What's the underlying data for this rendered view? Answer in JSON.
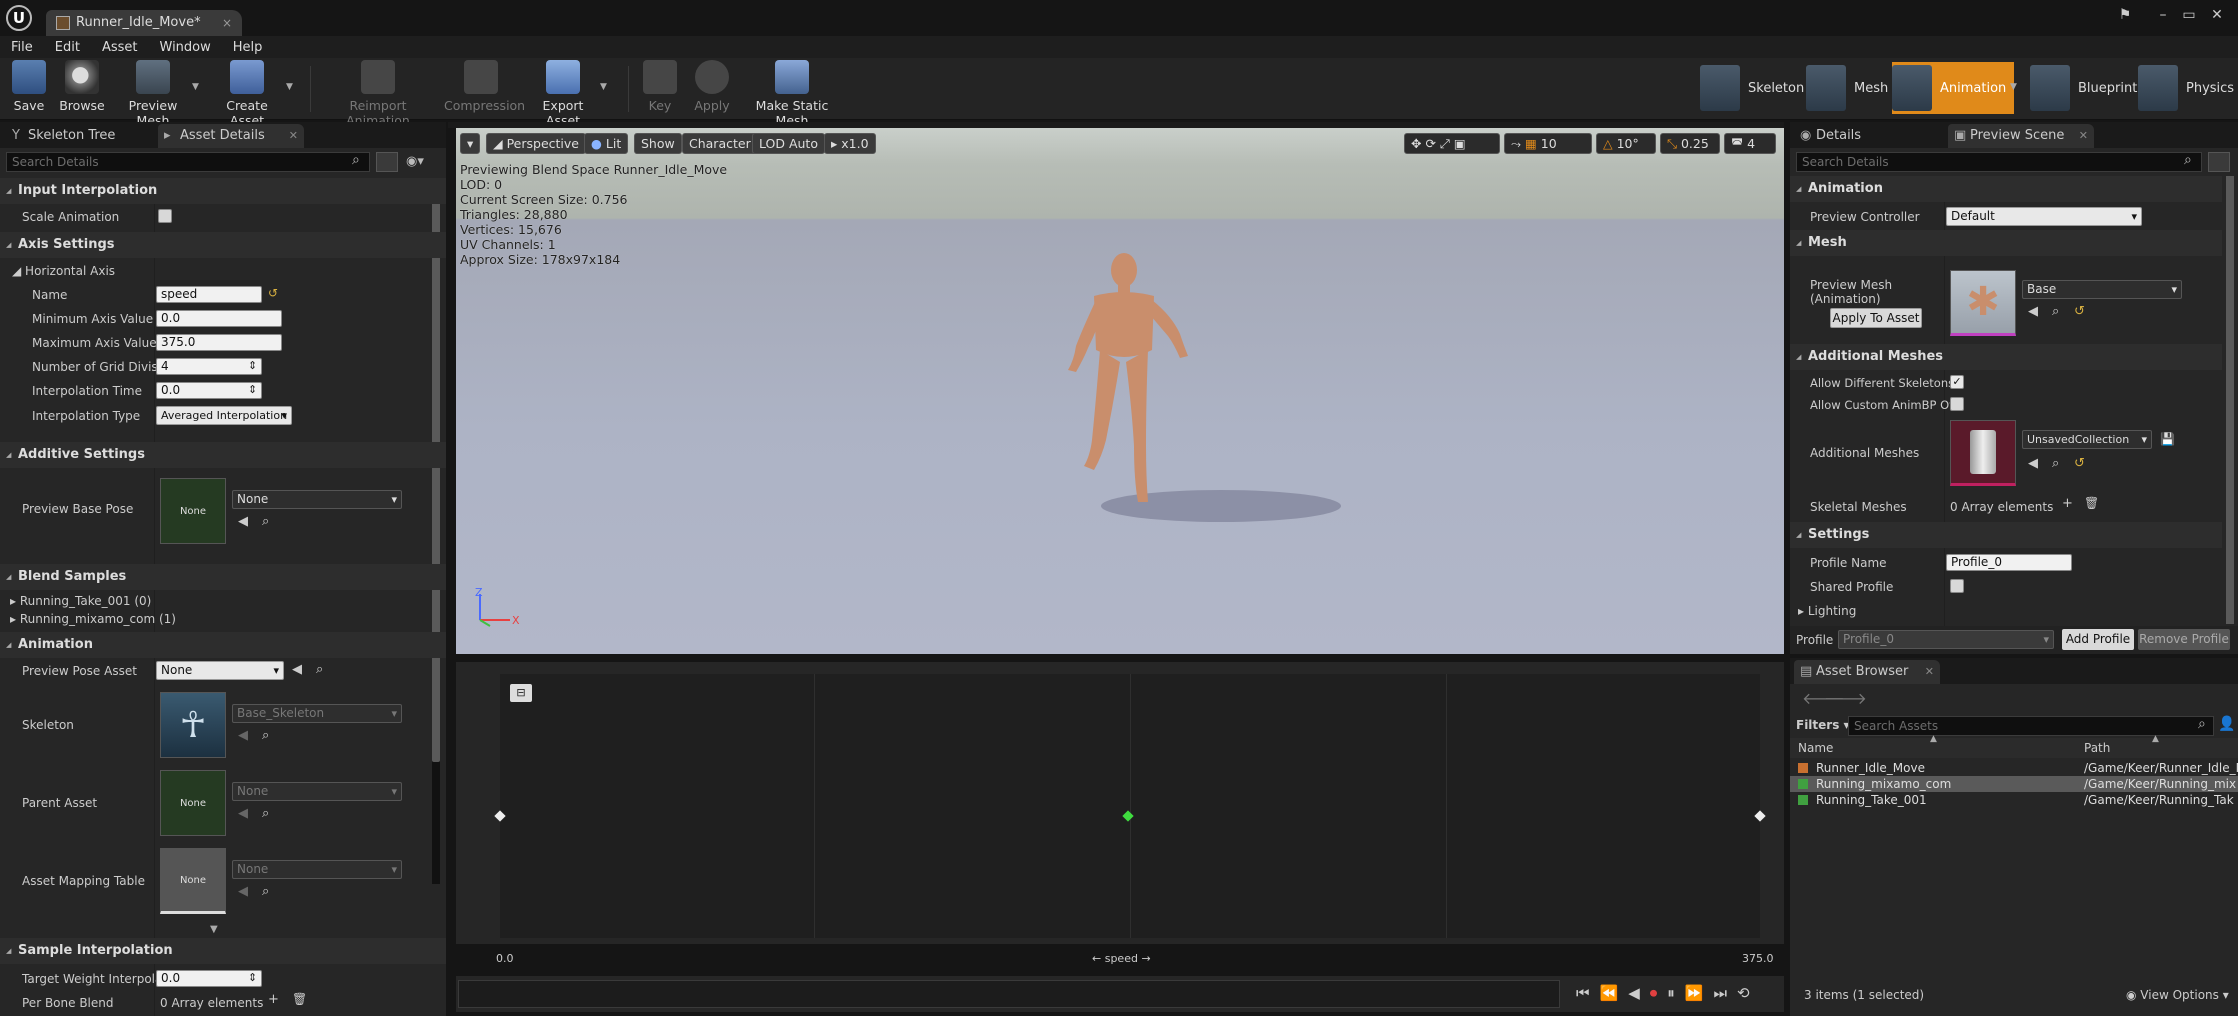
{
  "title_bar": {
    "tab_title": "Runner_Idle_Move*",
    "close_glyph": "×",
    "logo_glyph": "U"
  },
  "menu": [
    "File",
    "Edit",
    "Asset",
    "Window",
    "Help"
  ],
  "toolbar": {
    "save": "Save",
    "browse": "Browse",
    "preview_mesh": "Preview Mesh",
    "create_asset": "Create Asset",
    "reimport": "Reimport Animation",
    "compression": "Compression",
    "export_asset": "Export Asset",
    "key": "Key",
    "apply": "Apply",
    "make_static_mesh": "Make Static Mesh"
  },
  "modes": {
    "skeleton": "Skeleton",
    "mesh": "Mesh",
    "animation": "Animation",
    "blueprint": "Blueprint",
    "physics": "Physics"
  },
  "left_panel": {
    "tabs": {
      "skeleton_tree": "Skeleton Tree",
      "asset_details": "Asset Details"
    },
    "search_placeholder": "Search Details",
    "input_interpolation": {
      "header": "Input Interpolation",
      "scale_animation": "Scale Animation"
    },
    "axis_settings": {
      "header": "Axis Settings",
      "horizontal_axis": "Horizontal Axis",
      "name_label": "Name",
      "name_value": "speed",
      "min_label": "Minimum Axis Value",
      "min_value": "0.0",
      "max_label": "Maximum Axis Value",
      "max_value": "375.0",
      "grid_label": "Number of Grid Division",
      "grid_value": "4",
      "interp_time_label": "Interpolation Time",
      "interp_time_value": "0.0",
      "interp_type_label": "Interpolation Type",
      "interp_type_value": "Averaged Interpolation"
    },
    "additive": {
      "header": "Additive Settings",
      "preview_base_pose": "Preview Base Pose",
      "thumb_text": "None",
      "value": "None"
    },
    "blend_samples": {
      "header": "Blend Samples",
      "items": [
        "Running_Take_001 (0)",
        "Running_mixamo_com (1)"
      ]
    },
    "animation": {
      "header": "Animation",
      "preview_pose_label": "Preview Pose Asset",
      "preview_pose_value": "None",
      "skeleton_label": "Skeleton",
      "skeleton_value": "Base_Skeleton",
      "parent_label": "Parent Asset",
      "parent_value": "None",
      "parent_thumb": "None",
      "mapping_label": "Asset Mapping Table",
      "mapping_value": "None",
      "mapping_thumb": "None"
    },
    "sample_interp": {
      "header": "Sample Interpolation",
      "target_label": "Target Weight Interpolatio",
      "target_value": "0.0",
      "per_bone_label": "Per Bone Blend",
      "per_bone_value": "0 Array elements"
    }
  },
  "viewport": {
    "buttons": {
      "perspective": "Perspective",
      "lit": "Lit",
      "show": "Show",
      "character": "Character",
      "lod": "LOD Auto",
      "speed": "x1.0"
    },
    "right_values": {
      "grid": "10",
      "angle": "10°",
      "scale": "0.25",
      "cam": "4"
    },
    "stats": [
      "Previewing Blend Space Runner_Idle_Move",
      "LOD: 0",
      "Current Screen Size: 0.756",
      "Triangles: 28,880",
      "Vertices: 15,676",
      "UV Channels: 1",
      "Approx Size: 178x97x184"
    ],
    "axis_labels": {
      "x": "X",
      "z": "Z"
    }
  },
  "blend_space": {
    "x_min": "0.0",
    "x_max": "375.0",
    "axis_name": "speed",
    "left_arrow": "←",
    "right_arrow": "→"
  },
  "right_panel": {
    "tabs": {
      "details": "Details",
      "preview_scene": "Preview Scene Sett"
    },
    "search_placeholder": "Search Details",
    "animation": {
      "header": "Animation",
      "preview_controller_label": "Preview Controller",
      "preview_controller_value": "Default"
    },
    "mesh": {
      "header": "Mesh",
      "preview_mesh_label": "Preview Mesh (Animation)",
      "preview_mesh_value": "Base",
      "apply_button": "Apply To Asset"
    },
    "additional": {
      "header": "Additional Meshes",
      "allow_diff": "Allow Different Skeletons",
      "allow_custom": "Allow Custom AnimBP Ov",
      "additional_label": "Additional Meshes",
      "additional_value": "UnsavedCollection",
      "skeletal_label": "Skeletal Meshes",
      "skeletal_value": "0 Array elements"
    },
    "settings": {
      "header": "Settings",
      "profile_name_label": "Profile Name",
      "profile_name_value": "Profile_0",
      "shared_label": "Shared Profile",
      "lighting": "Lighting"
    },
    "profile_bar": {
      "label": "Profile",
      "value": "Profile_0",
      "add": "Add Profile",
      "remove": "Remove Profile"
    }
  },
  "asset_browser": {
    "tab": "Asset Browser",
    "filters": "Filters",
    "search_placeholder": "Search Assets",
    "col_name": "Name",
    "col_path": "Path",
    "rows": [
      {
        "name": "Runner_Idle_Move",
        "path": "/Game/Keer/Runner_Idle_M"
      },
      {
        "name": "Running_mixamo_com",
        "path": "/Game/Keer/Running_mix"
      },
      {
        "name": "Running_Take_001",
        "path": "/Game/Keer/Running_Tak"
      }
    ],
    "count": "3 items (1 selected)",
    "view_options": "View Options"
  }
}
